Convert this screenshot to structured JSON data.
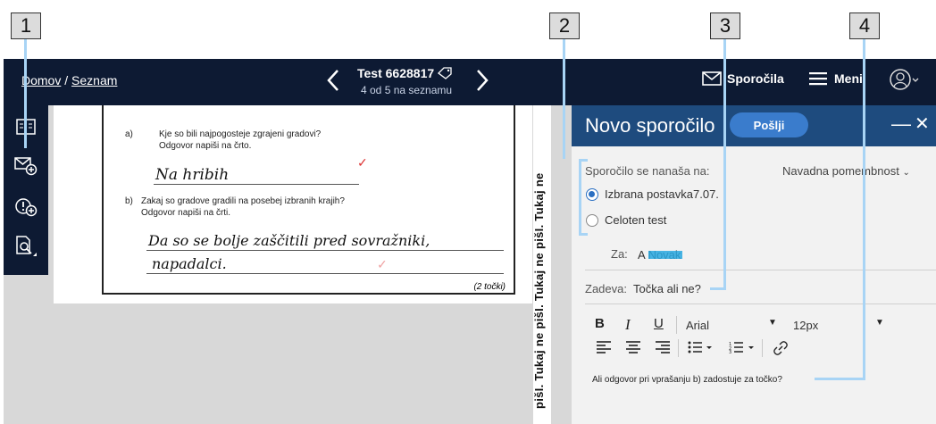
{
  "callouts": [
    "1",
    "2",
    "3",
    "4"
  ],
  "topbar": {
    "home": "Domov",
    "sep": "/",
    "list": "Seznam",
    "prev_icon": "chevron-left-icon",
    "next_icon": "chevron-right-icon",
    "test_title": "Test 6628817",
    "test_sub": "4 od 5 na seznamu",
    "messages_label": "Sporočila",
    "menu_label": "Meni",
    "user_icon": "user-icon"
  },
  "sidebar": {
    "items": [
      {
        "icon": "book-icon"
      },
      {
        "icon": "mail-add-icon"
      },
      {
        "icon": "alert-add-icon"
      },
      {
        "icon": "search-zoom-icon"
      }
    ]
  },
  "paper": {
    "qa_label": "a)",
    "qa_text": "Kje so bili najpogosteje zgrajeni gradovi?",
    "qa_hint": "Odgovor napiši na črto.",
    "qa_answer": "Na hribih",
    "qb_label": "b)",
    "qb_text": "Zakaj so gradove gradili na posebej izbranih krajih?",
    "qb_hint": "Odgovor napiši na črti.",
    "qb_answer_1": "Da so se bolje zaščitili pred sovražniki,",
    "qb_answer_2": "napadalci.",
    "points": "(2 točki)",
    "side_strip": "pišI. Tukaj ne pišI. Tukaj ne pišI. Tukaj ne"
  },
  "compose": {
    "title": "Novo sporočilo",
    "send": "Pošlji",
    "min": "—",
    "close": "✕",
    "relates_label": "Sporočilo se nanaša na:",
    "priority": "Navadna pomembnost",
    "opt_item": "Izbrana postavka7.07.",
    "opt_test": "Celoten test",
    "to_label": "Za:",
    "to_value": "A Novak",
    "subject_label": "Zadeva:",
    "subject_value": "Točka ali ne?",
    "font": "Arial",
    "size": "12px",
    "body": "Ali odgovor pri vprašanju b) zadostuje za točko?"
  },
  "colors": {
    "topbar": "#0d1a33",
    "compose_header": "#1e4b7e",
    "send": "#3a7ccc",
    "callout_line": "#a8d4f5"
  }
}
